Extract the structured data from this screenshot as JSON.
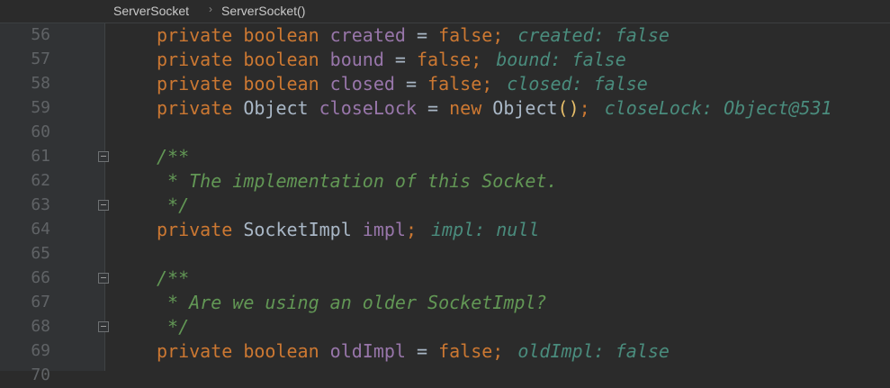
{
  "breadcrumb": {
    "items": [
      "ServerSocket",
      "ServerSocket()"
    ],
    "separator": "›"
  },
  "lines": [
    {
      "num": "56",
      "tokens": [
        [
          "kw",
          "private boolean "
        ],
        [
          "fld",
          "created"
        ],
        [
          "plain",
          " = "
        ],
        [
          "kw",
          "false;"
        ]
      ],
      "hint": "created: false"
    },
    {
      "num": "57",
      "tokens": [
        [
          "kw",
          "private boolean "
        ],
        [
          "fld",
          "bound"
        ],
        [
          "plain",
          " = "
        ],
        [
          "kw",
          "false;"
        ]
      ],
      "hint": "bound: false"
    },
    {
      "num": "58",
      "tokens": [
        [
          "kw",
          "private boolean "
        ],
        [
          "fld",
          "closed"
        ],
        [
          "plain",
          " = "
        ],
        [
          "kw",
          "false;"
        ]
      ],
      "hint": "closed: false"
    },
    {
      "num": "59",
      "tokens": [
        [
          "kw",
          "private "
        ],
        [
          "plain",
          "Object "
        ],
        [
          "fld",
          "closeLock"
        ],
        [
          "plain",
          " = "
        ],
        [
          "kw",
          "new "
        ],
        [
          "plain",
          "Object"
        ],
        [
          "paren",
          "()"
        ],
        [
          "kw",
          ";"
        ]
      ],
      "hint": "closeLock: Object@531"
    },
    {
      "num": "60",
      "tokens": [],
      "hint": ""
    },
    {
      "num": "61",
      "tokens": [
        [
          "cmt",
          "/**"
        ]
      ],
      "hint": "",
      "fold": true
    },
    {
      "num": "62",
      "tokens": [
        [
          "cmt",
          " * The implementation of this Socket."
        ]
      ],
      "hint": ""
    },
    {
      "num": "63",
      "tokens": [
        [
          "cmt",
          " */"
        ]
      ],
      "hint": "",
      "fold": true
    },
    {
      "num": "64",
      "tokens": [
        [
          "kw",
          "private "
        ],
        [
          "plain",
          "SocketImpl "
        ],
        [
          "fld",
          "impl"
        ],
        [
          "kw",
          ";"
        ]
      ],
      "hint": "impl: null"
    },
    {
      "num": "65",
      "tokens": [],
      "hint": ""
    },
    {
      "num": "66",
      "tokens": [
        [
          "cmt",
          "/**"
        ]
      ],
      "hint": "",
      "fold": true
    },
    {
      "num": "67",
      "tokens": [
        [
          "cmt",
          " * Are we using an older SocketImpl?"
        ]
      ],
      "hint": ""
    },
    {
      "num": "68",
      "tokens": [
        [
          "cmt",
          " */"
        ]
      ],
      "hint": "",
      "fold": true
    },
    {
      "num": "69",
      "tokens": [
        [
          "kw",
          "private boolean "
        ],
        [
          "fld",
          "oldImpl"
        ],
        [
          "plain",
          " = "
        ],
        [
          "kw",
          "false;"
        ]
      ],
      "hint": "oldImpl: false"
    },
    {
      "num": "70",
      "tokens": [],
      "hint": ""
    }
  ]
}
